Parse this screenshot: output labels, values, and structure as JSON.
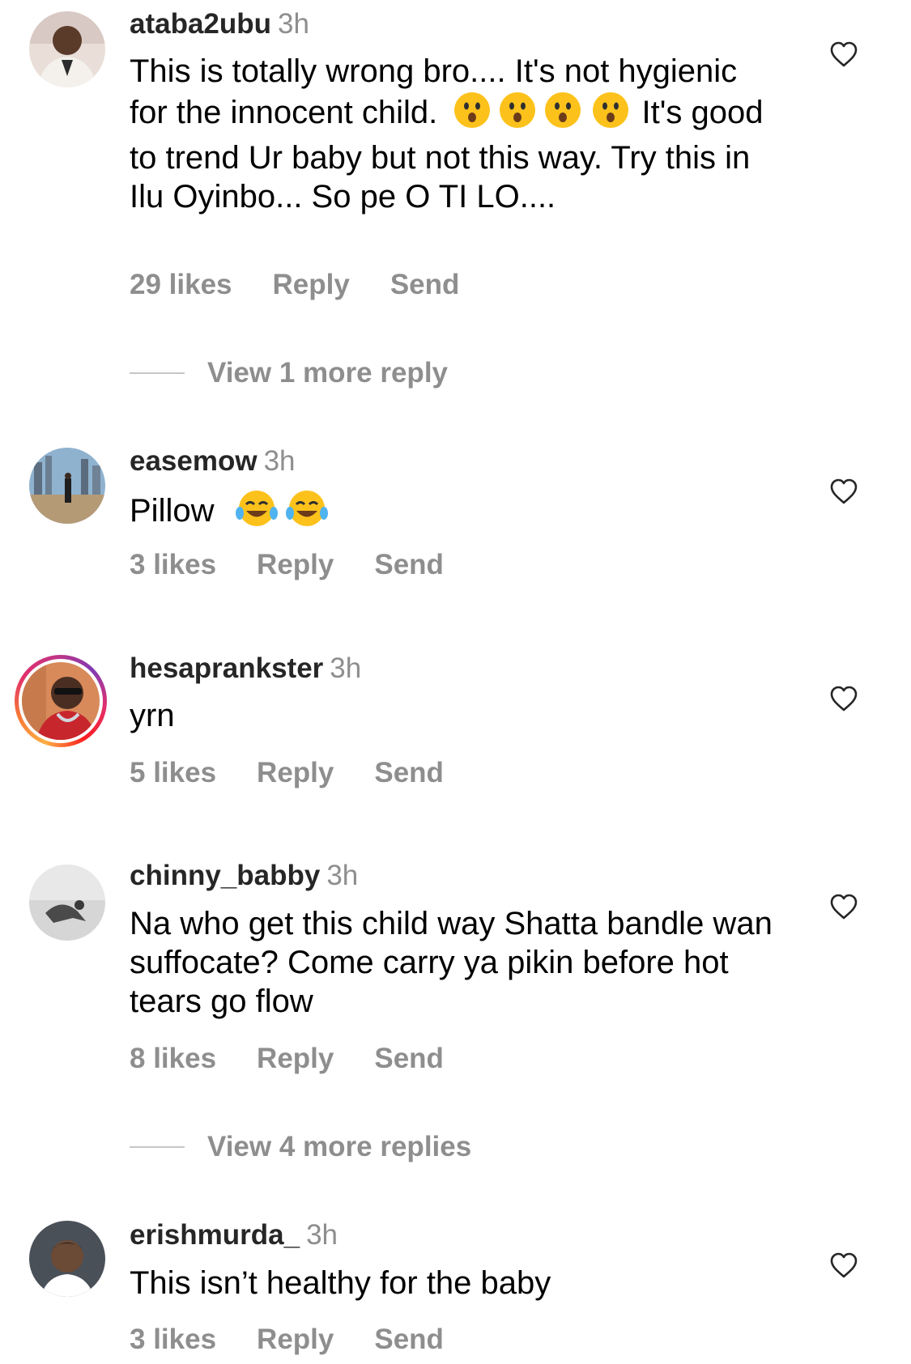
{
  "comments": [
    {
      "username": "ataba2ubu",
      "time": "3h",
      "text_parts": [
        "This is totally wrong bro.... It's not hygienic for the innocent child.",
        "It's good to trend Ur baby but not this way. Try this in Ilu Oyinbo... So pe O TI LO...."
      ],
      "emojis": [
        "astonished-face",
        "astonished-face",
        "astonished-face",
        "astonished-face"
      ],
      "likes": "29 likes",
      "reply_label": "Reply",
      "send_label": "Send",
      "view_replies": "View 1 more reply"
    },
    {
      "username": "easemow",
      "time": "3h",
      "text": "Pillow",
      "emojis": [
        "face-with-tears-of-joy",
        "face-with-tears-of-joy"
      ],
      "likes": "3 likes",
      "reply_label": "Reply",
      "send_label": "Send"
    },
    {
      "username": "hesaprankster",
      "time": "3h",
      "text": "yrn",
      "has_story_ring": true,
      "likes": "5 likes",
      "reply_label": "Reply",
      "send_label": "Send"
    },
    {
      "username": "chinny_babby",
      "time": "3h",
      "text": "Na who get this child way Shatta bandle wan suffocate? Come carry ya pikin before hot tears go flow",
      "likes": "8 likes",
      "reply_label": "Reply",
      "send_label": "Send",
      "view_replies": "View 4 more replies"
    },
    {
      "username": "erishmurda_",
      "time": "3h",
      "text": "This isn’t healthy for the baby",
      "likes": "3 likes",
      "reply_label": "Reply",
      "send_label": "Send"
    }
  ],
  "colors": {
    "username": "#262626",
    "secondary": "#8e8e8e",
    "divider": "#c7c7c7",
    "story_ring": "#e1306c"
  },
  "icons": {
    "like": "heart-outline-icon"
  }
}
